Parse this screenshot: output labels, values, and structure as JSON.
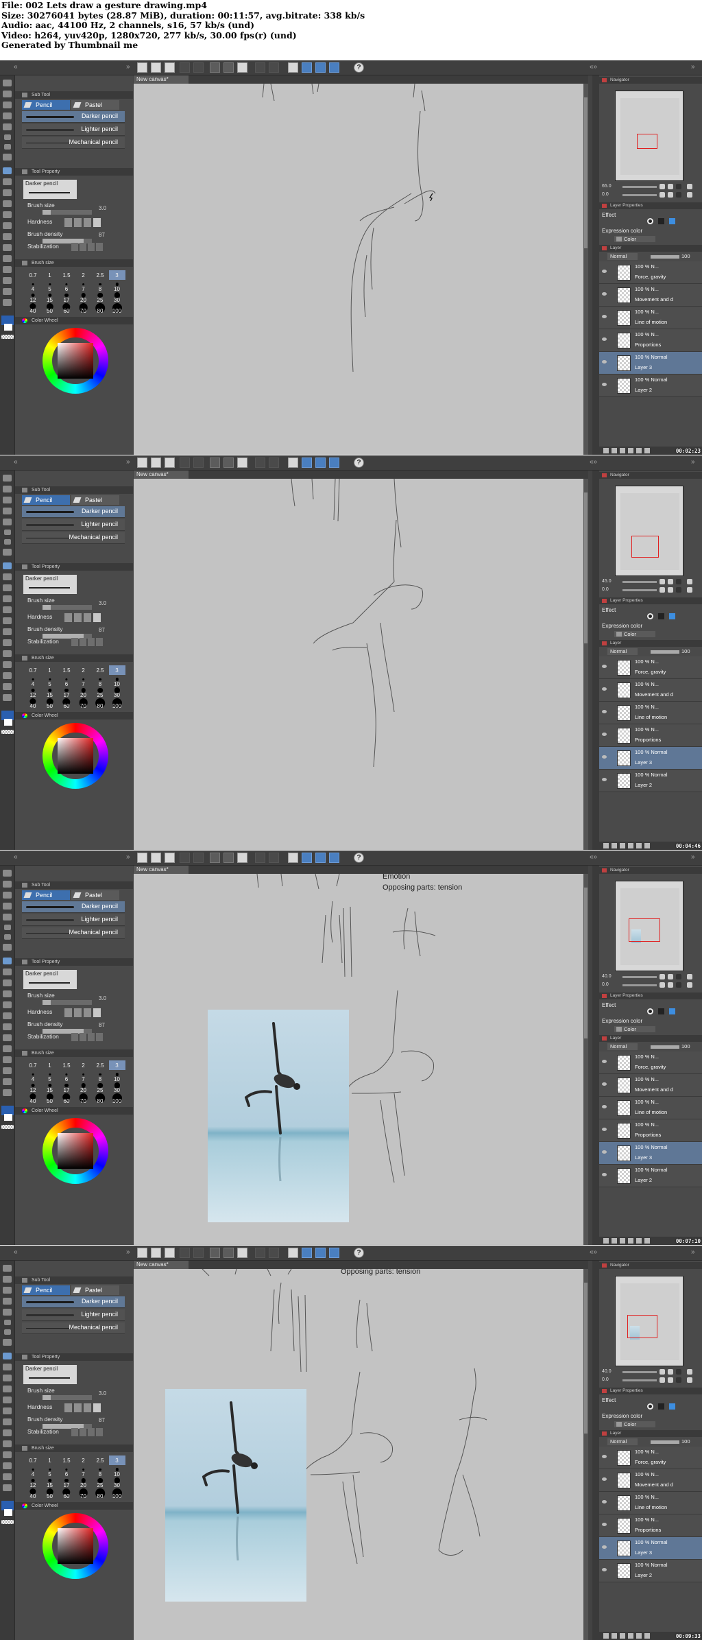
{
  "header": {
    "lines": [
      "File: 002 Lets draw a gesture drawing.mp4",
      "Size: 30276041 bytes (28.87 MiB), duration: 00:11:57, avg.bitrate: 338 kb/s",
      "Audio: aac, 44100 Hz, 2 channels, s16, 57 kb/s (und)",
      "Video: h264, yuv420p, 1280x720, 277 kb/s, 30.00 fps(r) (und)",
      "Generated by Thumbnail me"
    ]
  },
  "ui": {
    "canvas_tab": "New canvas*",
    "sub_tool_header": "Sub Tool",
    "tab_pencil": "Pencil",
    "tab_pastel": "Pastel",
    "brushes": [
      "Darker pencil",
      "Lighter pencil",
      "Mechanical pencil"
    ],
    "tool_property_header": "Tool Property",
    "tool_property_name": "Darker pencil",
    "brush_size_label": "Brush size",
    "brush_size_value": "3.0",
    "hardness_label": "Hardness",
    "brush_density_label": "Brush density",
    "brush_density_value": "87",
    "stabilization_label": "Stabilization",
    "brush_size_header": "Brush size",
    "brush_size_presets": [
      "0.7",
      "1",
      "1.5",
      "2",
      "2.5",
      "3",
      "4",
      "5",
      "6",
      "7",
      "8",
      "10",
      "12",
      "15",
      "17",
      "20",
      "25",
      "30",
      "40",
      "50",
      "60",
      "70",
      "80",
      "100"
    ],
    "color_header": "Color Wheel",
    "navigator_header": "Navigator",
    "layer_property_header": "Layer Properties",
    "effect_label": "Effect",
    "expression_color_label": "Expression color",
    "expression_color_value": "Color",
    "layer_header": "Layer",
    "blend_mode": "Normal",
    "opacity": "100",
    "layers": [
      {
        "meta": "100 %  N...",
        "name": "Force, gravity"
      },
      {
        "meta": "100 %  N...",
        "name": "Movement and d"
      },
      {
        "meta": "100 %  N...",
        "name": "Line of motion"
      },
      {
        "meta": "100 %  N...",
        "name": "Proportions"
      },
      {
        "meta": "100 %  Normal",
        "name": "Layer 3"
      },
      {
        "meta": "100 %  Normal",
        "name": "Layer 2"
      }
    ]
  },
  "frames": [
    {
      "timestamp": "00:02:23",
      "zoom": "65.0",
      "angle": "0.0",
      "texts": []
    },
    {
      "timestamp": "00:04:46",
      "zoom": "45.0",
      "angle": "0.0",
      "texts": []
    },
    {
      "timestamp": "00:07:10",
      "zoom": "40.0",
      "angle": "0.0",
      "texts": [
        "Emotion",
        "Opposing parts: tension"
      ]
    },
    {
      "timestamp": "00:09:33",
      "zoom": "40.0",
      "angle": "0.0",
      "texts": [
        "Opposing parts: tension"
      ]
    }
  ],
  "colors": {
    "panel": "#4a4a4a",
    "accent": "#3d6fae",
    "canvas": "#c3c3c3",
    "nav_frame": "#e02020"
  }
}
